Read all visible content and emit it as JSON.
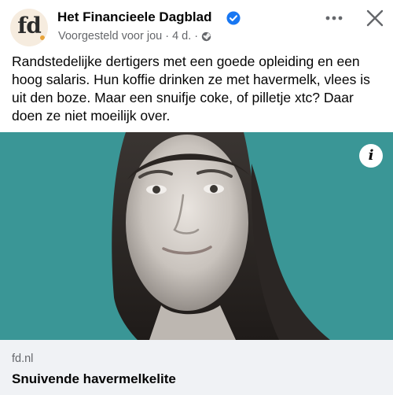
{
  "post": {
    "avatar_text": "fd",
    "page_name": "Het Financieele Dagblad",
    "verified_icon": "verified-badge-icon",
    "meta_text": "Voorgesteld voor jou · 4 d. ·",
    "audience_icon": "globe-icon",
    "caption": "Randstedelijke dertigers met een goede opleiding en een hoog salaris. Hun koffie drinken ze met havermelk, vlees is uit den boze. Maar een snuifje coke, of pilletje xtc? Daar doen ze niet moeilijk over."
  },
  "header_actions": {
    "more_icon": "more-options-icon",
    "close_icon": "close-icon"
  },
  "image": {
    "background_color": "#3a9696",
    "subject": "portrait-photo",
    "info_label": "i"
  },
  "link_preview": {
    "domain": "fd.nl",
    "title": "Snuivende havermelkelite"
  },
  "colors": {
    "verified_blue": "#1877f2",
    "secondary_text": "#65676b",
    "card_background": "#f0f2f5"
  }
}
